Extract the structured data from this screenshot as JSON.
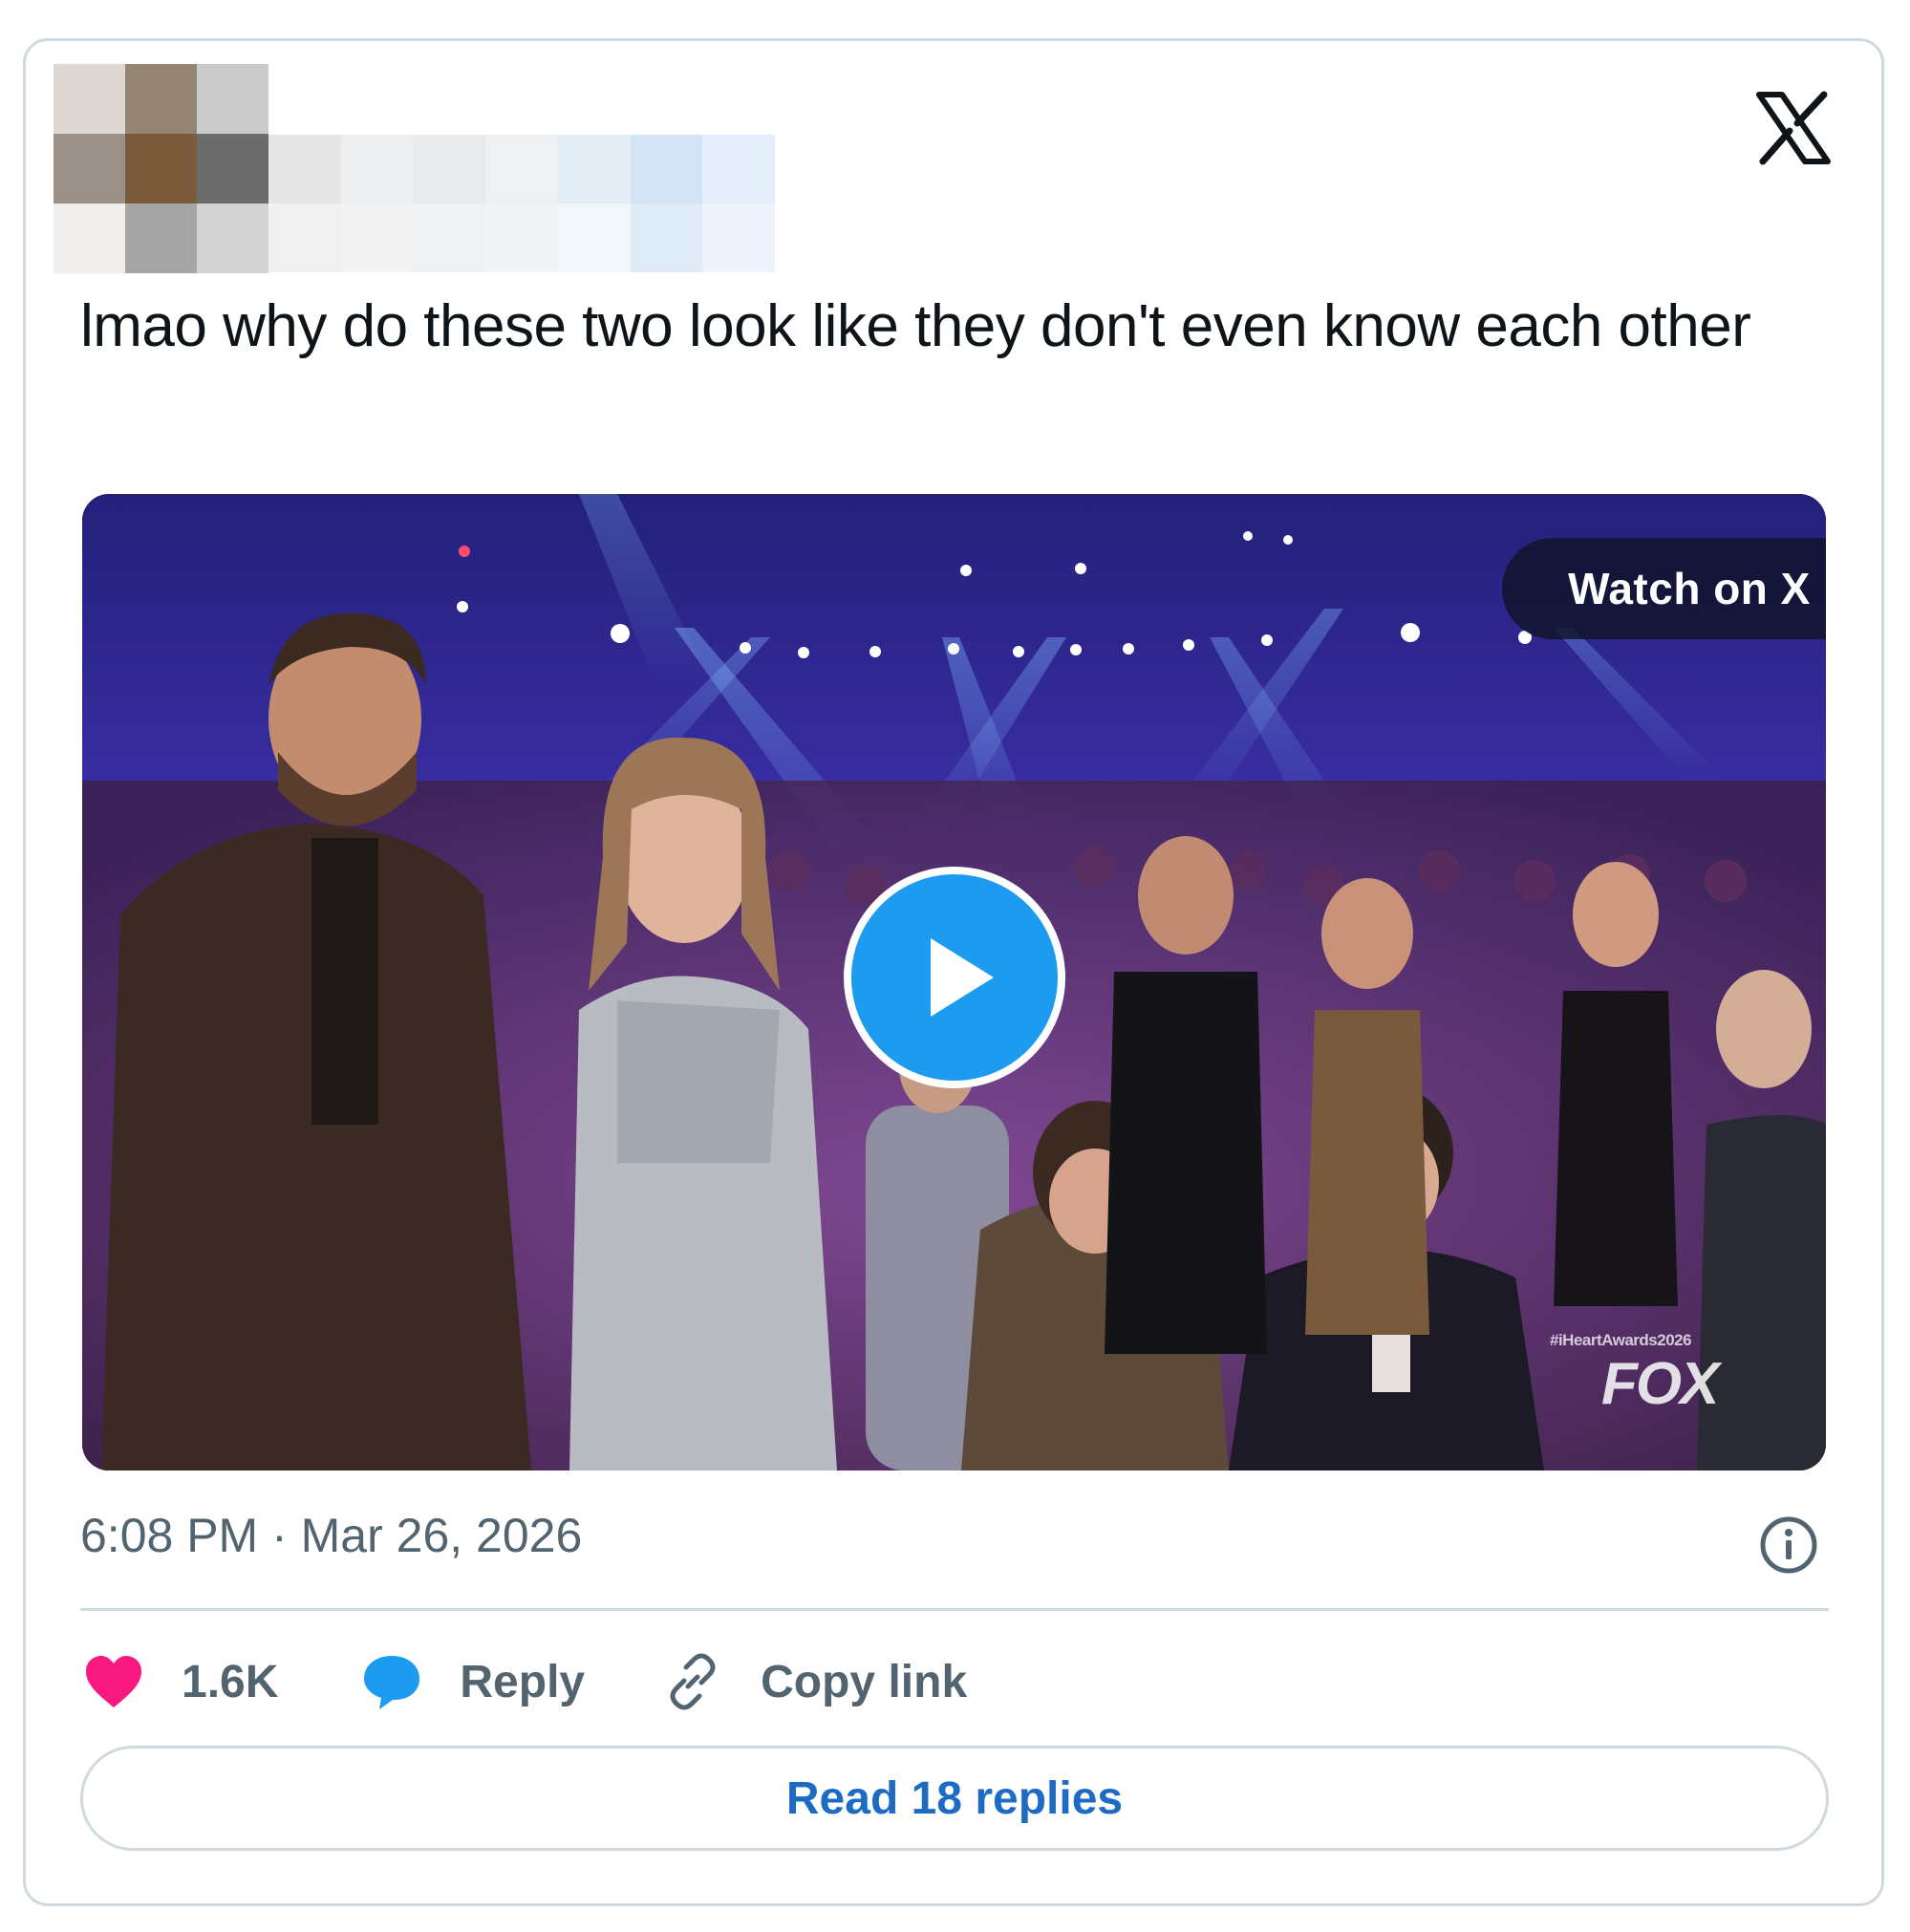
{
  "tweet": {
    "text": "lmao why do these two look like they don't even know each other",
    "timestamp": "6:08 PM · Mar 26, 2026"
  },
  "media": {
    "watch_label": "Watch on X",
    "watermark_hashtag": "#iHeartAwards2026",
    "watermark_network": "FOX"
  },
  "actions": {
    "likes": "1.6K",
    "reply_label": "Reply",
    "copy_label": "Copy link"
  },
  "footer": {
    "read_replies_label": "Read 18 replies"
  },
  "icons": {
    "brand": "x-logo-icon",
    "like": "heart-icon",
    "reply": "speech-bubble-icon",
    "copy": "link-icon",
    "info": "info-icon",
    "play": "play-icon"
  },
  "colors": {
    "like": "#f91880",
    "reply": "#1d9bf0",
    "link_text": "#1d6bc2",
    "muted_text": "#536471",
    "border": "#cfd9de"
  }
}
